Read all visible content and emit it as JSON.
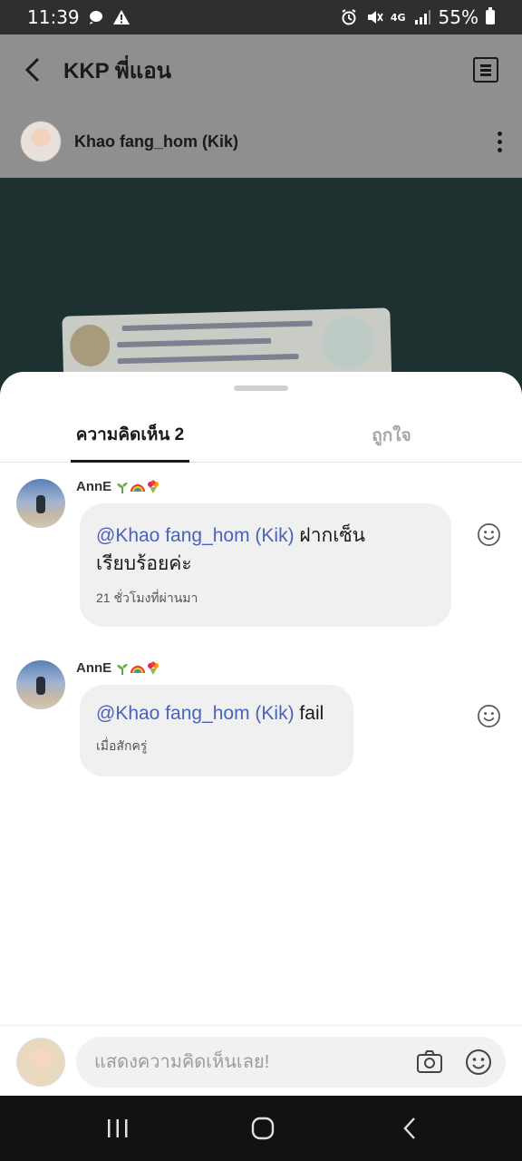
{
  "status_bar": {
    "time": "11:39",
    "battery": "55%",
    "network": "4G"
  },
  "background_app": {
    "title": "KKP พี่แอน",
    "poster_name": "Khao fang_hom (Kik)",
    "photo_subject": "id-card-photo"
  },
  "sheet": {
    "tabs": [
      {
        "label": "ความคิดเห็น 2",
        "active": true
      },
      {
        "label": "ถูกใจ",
        "active": false
      }
    ]
  },
  "comments": [
    {
      "author": "AnnE",
      "author_emojis": [
        "seedling-emoji",
        "rainbow-emoji",
        "bouquet-emoji"
      ],
      "mention": "@Khao fang_hom (Kik)",
      "text_line1": " ฝากเซ็น",
      "text_line2": "เรียบร้อยค่ะ",
      "time": "21 ชั่วโมงที่ผ่านมา"
    },
    {
      "author": "AnnE",
      "author_emojis": [
        "seedling-emoji",
        "rainbow-emoji",
        "bouquet-emoji"
      ],
      "mention": "@Khao fang_hom (Kik)",
      "text_line1": " fail",
      "time": "เมื่อสักครู่"
    }
  ],
  "composer": {
    "placeholder": "แสดงความคิดเห็นเลย!"
  },
  "colors": {
    "mention": "#4a63b8",
    "bubble": "#f0f0f0",
    "dim_overlay": "#8f8f8f",
    "nav_bar": "#121212"
  }
}
